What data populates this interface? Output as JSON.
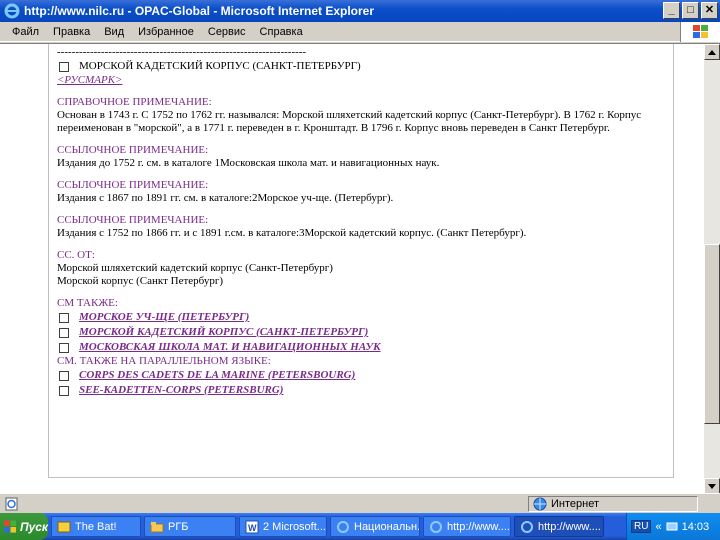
{
  "window": {
    "title": "http://www.nilc.ru - OPAC-Global - Microsoft Internet Explorer",
    "minimize": "_",
    "maximize": "□",
    "close": "✕"
  },
  "menu": [
    "Файл",
    "Правка",
    "Вид",
    "Избранное",
    "Сервис",
    "Справка"
  ],
  "content": {
    "dashes": "--------------------------------------------------------------------",
    "heading_entry": "МОРСКОЙ КАДЕТСКИЙ КОРПУС (САНКТ-ПЕТЕРБУРГ)",
    "rusmark": "<РУСМАРК>",
    "ref_note_title": "СПРАВОЧНОЕ ПРИМЕЧАНИЕ:",
    "ref_note_text": "Основан в 1743 г. С 1752 по 1762 гг. назывался: Морской шляхетский кадетский корпус (Санкт-Петербург). В 1762 г. Корпус переименован в \"морской\", а в 1771 г. переведен в г. Кронштадт. В 1796 г. Корпус вновь переведен в Санкт Петербург.",
    "ref1_title": "ССЫЛОЧНОЕ ПРИМЕЧАНИЕ:",
    "ref1_text": "Издания до 1752 г. см. в каталоге 1Московская школа мат. и навигационных наук.",
    "ref2_title": "ССЫЛОЧНОЕ ПРИМЕЧАНИЕ:",
    "ref2_text": "Издания с 1867 по 1891 гг. см. в каталоге:2Морское уч-ще. (Петербург).",
    "ref3_title": "ССЫЛОЧНОЕ ПРИМЕЧАНИЕ:",
    "ref3_text": "Издания с 1752 по 1866 гг. и с 1891 г.см. в каталоге:3Морской кадетский корпус. (Санкт Петербург).",
    "see_from_title": "СС. ОТ:",
    "see_from_items": [
      "Морской шляхетский кадетский корпус (Санкт-Петербург)",
      "Морской корпус (Санкт Петербург)"
    ],
    "see_also_title": "СМ ТАКЖЕ:",
    "see_also_links": [
      "МОРСКОЕ УЧ-ЩЕ (ПЕТЕРБУРГ)",
      "МОРСКОЙ КАДЕТСКИЙ КОРПУС (САНКТ-ПЕТЕРБУРГ)",
      "МОСКОВСКАЯ ШКОЛА МАТ. И НАВИГАЦИОННЫХ НАУК"
    ],
    "parallel_title": "СМ. ТАКЖЕ НА ПАРАЛЛЕЛЬНОМ ЯЗЫКЕ:",
    "parallel_links": [
      "CORPS DES CADETS DE LA MARINE (PETERSBOURG)",
      "SEE-KADETTEN-CORPS (PETERSBURG)"
    ]
  },
  "status": {
    "zone": "Интернет"
  },
  "taskbar": {
    "start": "Пуск",
    "tasks": [
      "The Bat!",
      "РГБ",
      "2 Microsoft...",
      "Национальн...",
      "http://www....",
      "http://www...."
    ],
    "lang": "RU",
    "clock": "14:03"
  },
  "colors": {
    "link": "#7a2a8a",
    "titlebar": "#0a4fc9"
  }
}
